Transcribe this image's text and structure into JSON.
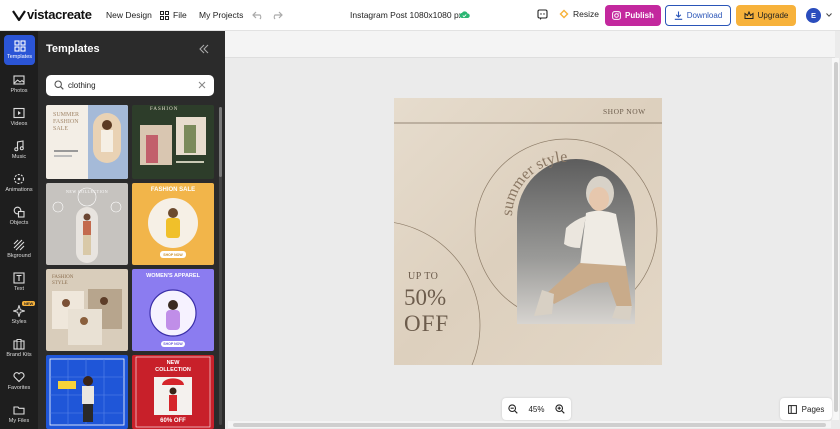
{
  "brand": {
    "name": "vistacreate",
    "accent": "#2b55d6"
  },
  "topbar": {
    "nav": [
      {
        "label": "New Design"
      },
      {
        "label": "File",
        "icon": "grid-icon"
      },
      {
        "label": "My Projects"
      }
    ],
    "doc_title": "Instagram Post 1080x1080 px",
    "resize_label": "Resize",
    "publish_label": "Publish",
    "download_label": "Download",
    "upgrade_label": "Upgrade",
    "avatar_initial": "E",
    "colors": {
      "publish": "#c3289e",
      "upgrade": "#f7b23b",
      "download": "#2a55b8"
    }
  },
  "rail": {
    "items": [
      {
        "label": "Templates",
        "icon": "templates-icon",
        "active": true
      },
      {
        "label": "Photos",
        "icon": "photo-icon"
      },
      {
        "label": "Videos",
        "icon": "video-icon"
      },
      {
        "label": "Music",
        "icon": "music-icon"
      },
      {
        "label": "Animations",
        "icon": "animation-icon"
      },
      {
        "label": "Objects",
        "icon": "objects-icon"
      },
      {
        "label": "Bkground",
        "icon": "background-icon"
      },
      {
        "label": "Text",
        "icon": "text-icon"
      },
      {
        "label": "Styles",
        "icon": "styles-icon",
        "badge": "NEW"
      },
      {
        "label": "Brand Kits",
        "icon": "brand-kit-icon"
      },
      {
        "label": "Favorites",
        "icon": "heart-icon"
      },
      {
        "label": "My Files",
        "icon": "folder-icon"
      }
    ]
  },
  "panel": {
    "title": "Templates",
    "search": {
      "value": "clothing",
      "placeholder": "Search"
    },
    "templates": [
      {
        "text_lines": [
          "SUMMER",
          "FASHION",
          "SALE"
        ],
        "bg": "#f3eee6"
      },
      {
        "text_lines": [
          "FASHION"
        ],
        "bg": "#2d3d2a"
      },
      {
        "text_lines": [
          "NEW COLLECTION"
        ],
        "bg": "#c6c3bf"
      },
      {
        "text_lines": [
          "FASHION SALE",
          "SHOP NOW"
        ],
        "bg": "#f2b54a"
      },
      {
        "text_lines": [
          "FASHION",
          "STYLE"
        ],
        "bg": "#d9cdbb"
      },
      {
        "text_lines": [
          "WOMEN'S APPAREL",
          "SHOP NOW"
        ],
        "bg": "#8b7cf0"
      },
      {
        "text_lines": [],
        "bg": "#1f56d8"
      },
      {
        "text_lines": [
          "NEW",
          "COLLECTION",
          "60% OFF"
        ],
        "bg": "#c8202a"
      }
    ]
  },
  "design": {
    "shop_now": "SHOP NOW",
    "arc_text": "summer style",
    "up_to": "UP TO",
    "percent": "50%",
    "off": "OFF",
    "bg": "#e2d6c6"
  },
  "zoom": {
    "level": "45%"
  },
  "pages_label": "Pages"
}
